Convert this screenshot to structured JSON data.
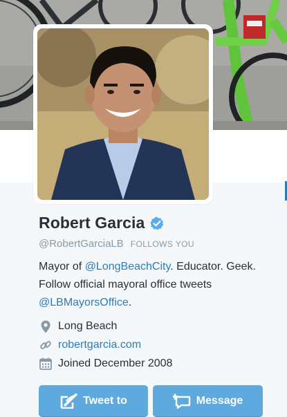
{
  "profile": {
    "name": "Robert Garcia",
    "handle": "@RobertGarciaLB",
    "follows_you": "FOLLOWS YOU",
    "bio": {
      "part1": "Mayor of ",
      "mention1": "@LongBeachCity",
      "part2": ". Educator. Geek. Follow official mayoral office tweets ",
      "mention2": "@LBMayorsOffice",
      "part3": "."
    },
    "location": "Long Beach",
    "website": "robertgarcia.com",
    "joined": "Joined December 2008"
  },
  "actions": {
    "tweet_to": "Tweet to",
    "message": "Message"
  },
  "icons": {
    "verified": "verified-badge-icon",
    "location": "location-pin-icon",
    "website": "link-icon",
    "joined": "calendar-icon",
    "tweet_to": "compose-icon",
    "message": "message-icon"
  },
  "colors": {
    "accent": "#2b7bb9",
    "button": "#5ea9dd",
    "verified": "#55acee",
    "muted": "#8899a6",
    "text": "#292f33"
  }
}
